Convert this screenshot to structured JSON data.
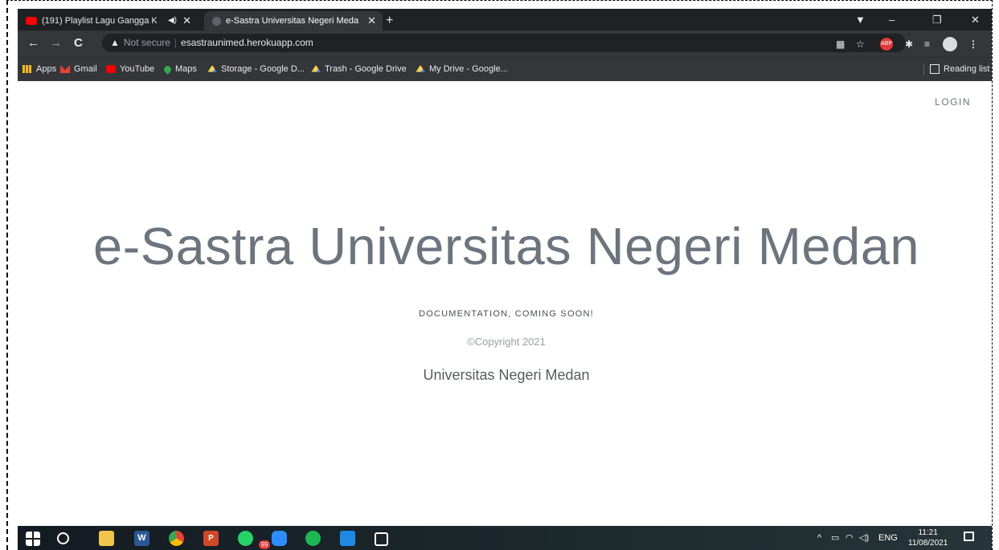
{
  "browser": {
    "tabs": [
      {
        "label": "(191) Playlist Lagu Gangga K",
        "favicon": "youtube-icon",
        "audio": true,
        "active": false
      },
      {
        "label": "e-Sastra Universitas Negeri Meda",
        "favicon": "globe-icon",
        "audio": false,
        "active": true
      }
    ],
    "new_tab": "+",
    "window_controls": {
      "minimize": "–",
      "restore": "❐",
      "close": "✕"
    },
    "toolbar": {
      "back": "←",
      "forward": "→",
      "reload": "C",
      "security_icon": "▲",
      "security_label": "Not secure",
      "separator": "|",
      "url": "esastraunimed.herokuapp.com"
    },
    "bookmarks": [
      {
        "label": "Apps",
        "icon": "apps-icon"
      },
      {
        "label": "Gmail",
        "icon": "gmail-icon"
      },
      {
        "label": "YouTube",
        "icon": "youtube-icon"
      },
      {
        "label": "Maps",
        "icon": "maps-icon"
      },
      {
        "label": "Storage - Google D...",
        "icon": "drive-icon"
      },
      {
        "label": "Trash - Google Drive",
        "icon": "drive-icon"
      },
      {
        "label": "My Drive - Google...",
        "icon": "drive-icon"
      }
    ],
    "reading_list": "Reading list",
    "extensions": {
      "abp": "ABP"
    }
  },
  "page": {
    "nav_login": "LOGIN",
    "title": "e-Sastra Universitas Negeri Medan",
    "subtitle": "DOCUMENTATION, COMING SOON!",
    "copyright": "©Copyright 2021",
    "university": "Universitas Negeri Medan"
  },
  "taskbar": {
    "whatsapp_badge": "99",
    "tray_chevron": "^",
    "language": "ENG",
    "time": "11:21",
    "date": "11/08/2021"
  },
  "colors": {
    "browser_dark": "#202124",
    "browser_toolbar": "#35363a",
    "page_text": "#6c757d"
  }
}
